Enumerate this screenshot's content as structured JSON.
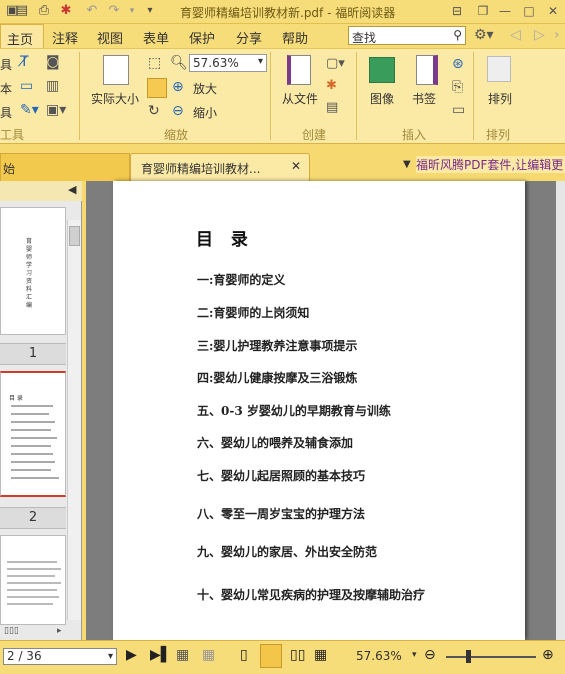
{
  "window": {
    "title": "育婴师精编培训教材新.pdf - 福昕阅读器"
  },
  "menu": {
    "items": [
      "主页",
      "注释",
      "视图",
      "表单",
      "保护",
      "分享",
      "帮助"
    ],
    "active": "主页",
    "search_value": "查找"
  },
  "ribbon": {
    "left_partial": [
      "具",
      "本",
      "具"
    ],
    "actual_size": "实际大小",
    "zoom_value": "57.63%",
    "zoom_in": "放大",
    "zoom_out": "缩小",
    "from_file": "从文件",
    "image": "图像",
    "bookmark": "书签",
    "arrange": "排列",
    "arrange_group": "排列",
    "groups": {
      "tools": "工具",
      "zoom": "缩放",
      "create": "创建",
      "insert": "插入"
    }
  },
  "tabs": {
    "start": "始",
    "doc": "育婴师精编培训教材...",
    "promo": "福昕风腾PDF套件,让编辑更自"
  },
  "left_panel": {
    "thumb1_text": "育婴师学习资料汇编",
    "page_labels": [
      "1",
      "2"
    ],
    "thumb2_title": "目 录"
  },
  "document": {
    "toc_title": "目 录",
    "toc": [
      "一:育婴师的定义",
      "二:育婴师的上岗须知",
      "三:婴儿护理教养注意事项提示",
      "四:婴幼儿健康按摩及三浴锻炼",
      "五、0-3 岁婴幼儿的早期教育与训练",
      "六、婴幼儿的喂养及辅食添加",
      "七、婴幼儿起居照顾的基本技巧",
      "八、零至一周岁宝宝的护理方法",
      "九、婴幼儿的家居、外出安全防范",
      "十、婴幼儿常见疾病的护理及按摩辅助治疗"
    ]
  },
  "status": {
    "page_value": "2 / 36",
    "zoom": "57.63%"
  },
  "colors": {
    "accent": "#f7dc7a",
    "ribbon": "#fbe9a6",
    "viewer_bg": "#7d7d7d"
  }
}
